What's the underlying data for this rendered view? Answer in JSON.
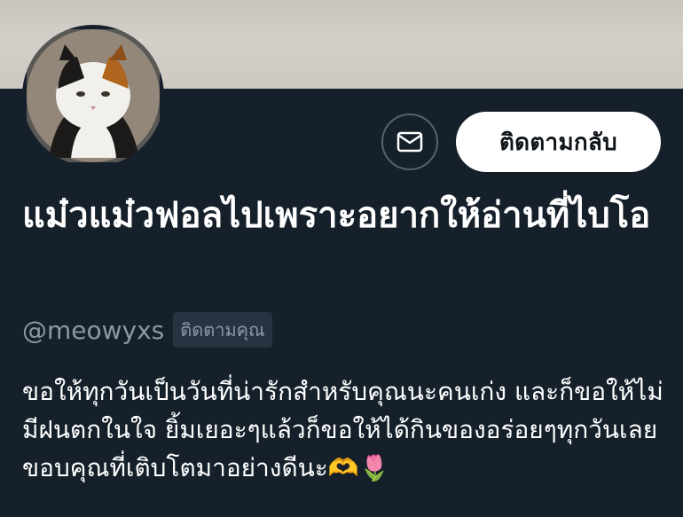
{
  "profile": {
    "follow_back_label": "ติดตามกลับ",
    "display_name": "แม๋วแม๋วฟอลไปเพราะอยากให้อ่านที่ไบโอ",
    "handle": "@meowyxs",
    "follows_you_badge": "ติดตามคุณ",
    "bio": "ขอให้ทุกวันเป็นวันที่น่ารักสำหรับคุณนะคนเก่ง และก็ขอให้ไม่มีฝนตกในใจ ยิ้มเยอะๆแล้วก็ขอให้ได้กินของอร่อยๆทุกวันเลย ขอบคุณที่เติบโตมาอย่างดีนะ🫶🌷"
  },
  "icons": {
    "message": "envelope-icon",
    "avatar": "calico-cat-photo"
  },
  "colors": {
    "background": "#15202b",
    "banner": "#cdc8c1",
    "button_bg": "#ffffff",
    "button_text": "#0f1419",
    "secondary_text": "#8b98a5",
    "badge_bg": "#273340",
    "border": "#536471"
  }
}
